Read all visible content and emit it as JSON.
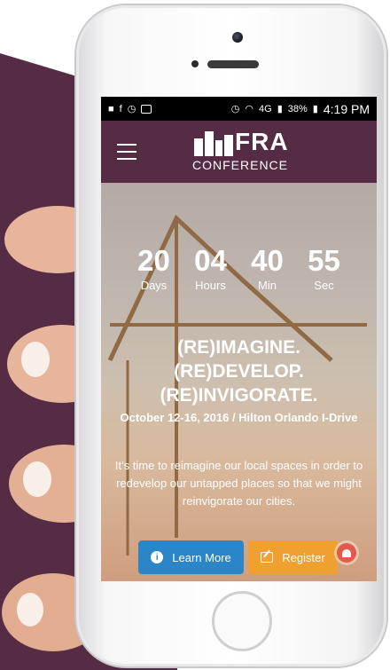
{
  "status_bar": {
    "battery": "38%",
    "network": "4G",
    "time": "4:19 PM"
  },
  "nav": {
    "logo_main": "FRA",
    "logo_sub": "CONFERENCE"
  },
  "countdown": [
    {
      "value": "20",
      "label": "Days"
    },
    {
      "value": "04",
      "label": "Hours"
    },
    {
      "value": "40",
      "label": "Min"
    },
    {
      "value": "55",
      "label": "Sec"
    }
  ],
  "hero": {
    "headline": [
      "(RE)IMAGINE.",
      "(RE)DEVELOP.",
      "(RE)INVIGORATE."
    ],
    "event_info": "October 12-16, 2016  /  Hilton Orlando I-Drive",
    "tagline": "It’s time to reimagine our local spaces in order to redevelop our untapped places so that we might reinvigorate our cities."
  },
  "buttons": {
    "learn_more": "Learn More",
    "register": "Register"
  },
  "colors": {
    "brand_plum": "#552c44",
    "learn_blue": "#2b85c9",
    "register_orange": "#f0a030",
    "notify_red": "#e35a4a"
  }
}
